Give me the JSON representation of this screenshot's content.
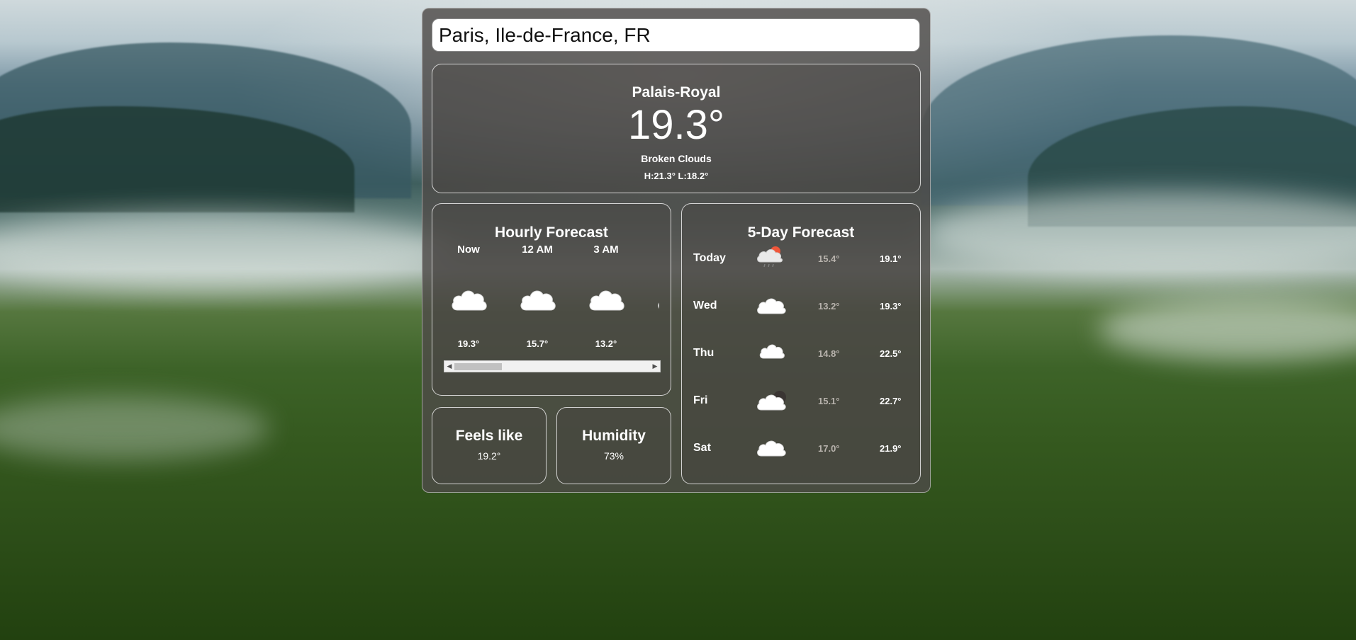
{
  "search": {
    "value": "Paris, Ile-de-France, FR"
  },
  "current": {
    "place": "Palais-Royal",
    "temp": "19.3°",
    "desc": "Broken Clouds",
    "hilo": "H:21.3° L:18.2°"
  },
  "hourly": {
    "title": "Hourly Forecast",
    "items": [
      {
        "label": "Now",
        "icon": "cloud-icon",
        "temp": "19.3°"
      },
      {
        "label": "12 AM",
        "icon": "cloud-icon",
        "temp": "15.7°"
      },
      {
        "label": "3 AM",
        "icon": "cloud-icon",
        "temp": "13.2°"
      }
    ],
    "scroll_position": 0.0
  },
  "feels": {
    "title": "Feels like",
    "value": "19.2°"
  },
  "humidity": {
    "title": "Humidity",
    "value": "73%"
  },
  "daily": {
    "title": "5-Day Forecast",
    "days": [
      {
        "name": "Today",
        "icon": "rain-sun-icon",
        "low": "15.4°",
        "high": "19.1°"
      },
      {
        "name": "Wed",
        "icon": "cloud-icon",
        "low": "13.2°",
        "high": "19.3°"
      },
      {
        "name": "Thu",
        "icon": "cloud-icon",
        "low": "14.8°",
        "high": "22.5°"
      },
      {
        "name": "Fri",
        "icon": "cloud-moon-icon",
        "low": "15.1°",
        "high": "22.7°"
      },
      {
        "name": "Sat",
        "icon": "cloud-icon",
        "low": "17.0°",
        "high": "21.9°"
      }
    ]
  }
}
